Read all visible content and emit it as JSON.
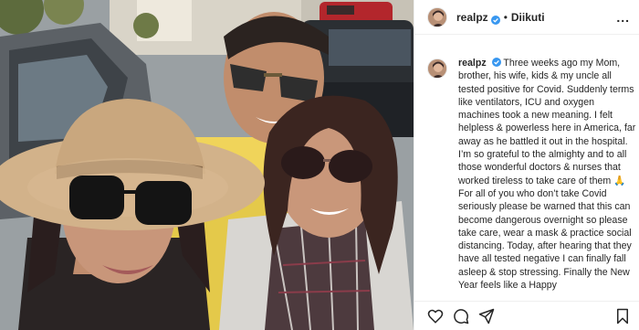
{
  "post": {
    "username": "realpz",
    "verified": true,
    "separator": "•",
    "follow_label": "Diikuti",
    "more_label": "...",
    "caption_user": "realpz",
    "caption_text": "Three weeks ago my Mom, brother, his wife, kids & my uncle all tested positive for Covid. Suddenly terms like ventilators, ICU and oxygen machines took a new meaning. I felt helpless & powerless here in America, far away as he battled it out in the hospital. I’m so grateful to the almighty and to all those wonderful doctors & nurses that worked tireless to take care of them 🙏 For all of you who don’t take Covid seriously please be warned that this can become dangerous overnight so please take care, wear a mask & practice social distancing. Today, after hearing that they have all tested negative I can finally fall asleep & stop stressing. Finally the New Year feels like a Happy"
  },
  "actions": {
    "like_icon": "heart-icon",
    "comment_icon": "comment-icon",
    "share_icon": "share-icon",
    "save_icon": "bookmark-icon"
  },
  "colors": {
    "text": "#262626",
    "verified_badge": "#3897f0",
    "border": "#efefef"
  }
}
